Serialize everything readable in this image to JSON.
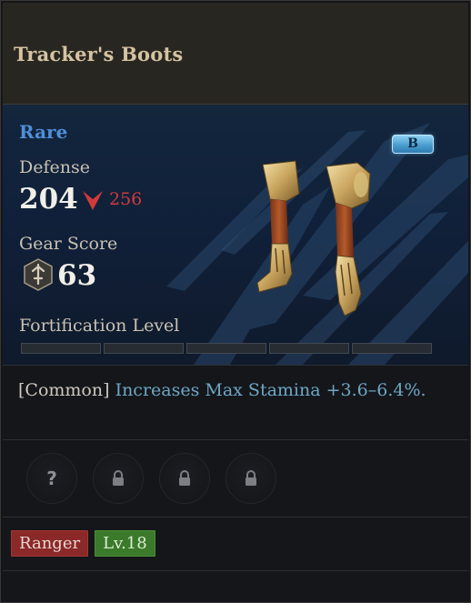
{
  "item": {
    "name": "Tracker's Boots",
    "rarity": "Rare",
    "grade": "B"
  },
  "stats": {
    "defense_label": "Defense",
    "defense_value": "204",
    "defense_compare": "256",
    "gear_score_label": "Gear Score",
    "gear_score_value": "63",
    "fortification_label": "Fortification Level",
    "fortification_level": 0,
    "fortification_max": 5
  },
  "trait": {
    "prefix": "[Common]",
    "text": "Increases Max Stamina +3.6–6.4%."
  },
  "slots": [
    {
      "icon": "question-icon",
      "glyph": "?"
    },
    {
      "icon": "lock-icon"
    },
    {
      "icon": "lock-icon"
    },
    {
      "icon": "lock-icon"
    }
  ],
  "requirements": {
    "class": "Ranger",
    "level": "Lv.18"
  },
  "colors": {
    "rarity": "#4f8fd8",
    "defense_down": "#d23a3a",
    "class_tag": "#8b2828",
    "level_tag": "#3b7a2a"
  }
}
